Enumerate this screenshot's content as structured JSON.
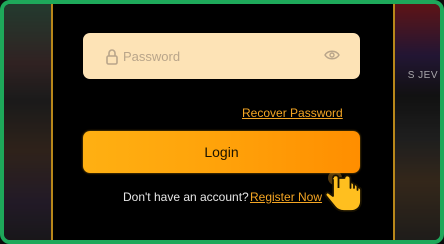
{
  "background": {
    "right_thumbnail_text": "S JEV"
  },
  "password": {
    "placeholder": "Password",
    "value": "",
    "lock_icon": "lock-icon",
    "eye_icon": "eye-icon"
  },
  "recover_password_label": "Recover Password",
  "login_label": "Login",
  "register": {
    "question": "Don't have an account?",
    "link_label": "Register Now",
    "pointer_icon": "hand-pointer-icon"
  },
  "colors": {
    "frame_border": "#1ea85a",
    "panel_border": "#b8871a",
    "field_bg": "#fde3b6",
    "accent": "#f5a623",
    "button_start": "#ffb012",
    "button_end": "#ff8e00"
  }
}
